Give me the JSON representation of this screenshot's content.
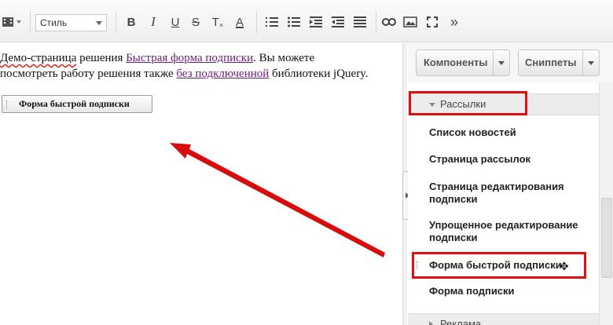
{
  "toolbar": {
    "style_select": "Стиль",
    "buttons": [
      "bold",
      "italic",
      "underline",
      "strike",
      "clear-format",
      "font-color",
      "ordered-list",
      "bullet-list",
      "indent",
      "outdent",
      "justify",
      "link",
      "image",
      "fullscreen",
      "more"
    ],
    "bold_glyph": "B",
    "italic_glyph": "I",
    "underline_glyph": "U",
    "strike_glyph": "S",
    "clear_glyph": "T",
    "color_glyph": "A",
    "more_glyph": "»"
  },
  "content": {
    "line1_prefix": "Демо-страница",
    "line1_mid": " решения ",
    "link1": "Быстрая форма подписки",
    "line1_suffix": ". Вы можете",
    "line2_prefix": "посмотреть работу решения также ",
    "link2": "без подключенной",
    "line2_suffix": " библиотеки jQuery.",
    "component_block": "Форма быстрой подписки"
  },
  "panel": {
    "components_btn": "Компоненты",
    "snippets_btn": "Сниппеты",
    "group_mailings": "Рассылки",
    "items": [
      "Список новостей",
      "Страница рассылок",
      "Страница редактирования подписки",
      "Упрощенное редактирование подписки",
      "Форма быстрой подписки",
      "Форма подписки"
    ],
    "group_ads": "Реклама"
  },
  "colors": {
    "highlight": "#e01010",
    "link": "#6b1e7a"
  }
}
